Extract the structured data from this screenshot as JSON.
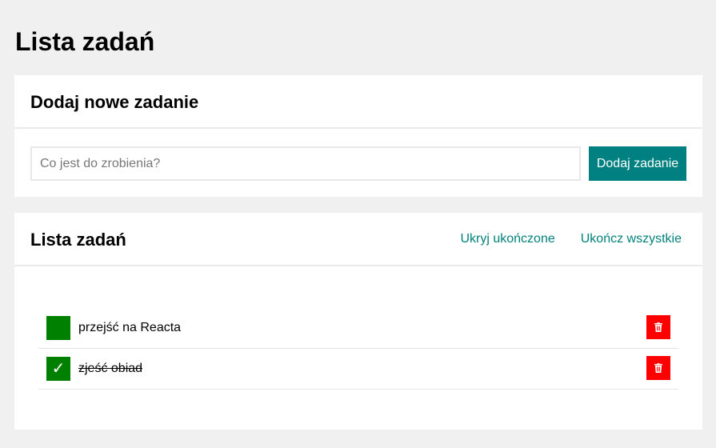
{
  "page": {
    "title": "Lista zadań"
  },
  "add_card": {
    "title": "Dodaj nowe zadanie",
    "input_placeholder": "Co jest do zrobienia?",
    "input_value": "",
    "button_label": "Dodaj zadanie"
  },
  "list_card": {
    "title": "Lista zadań",
    "hide_completed_label": "Ukryj ukończone",
    "complete_all_label": "Ukończ wszystkie",
    "tasks": [
      {
        "text": "przejść na Reacta",
        "done": false,
        "check_glyph": ""
      },
      {
        "text": "zjeść obiad",
        "done": true,
        "check_glyph": "✓"
      }
    ]
  },
  "colors": {
    "accent": "#008080",
    "checkbox": "#008000",
    "delete": "#ff0000",
    "background": "#f0f0f0"
  },
  "icons": {
    "delete": "trash-icon",
    "check": "checkmark-icon"
  }
}
